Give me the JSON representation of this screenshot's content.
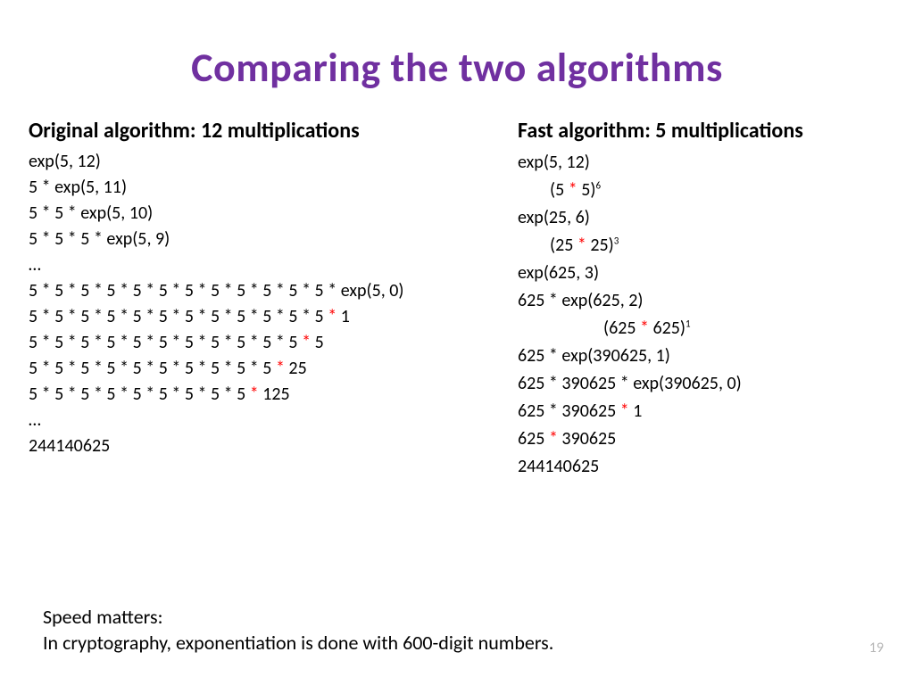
{
  "title": "Comparing the two algorithms",
  "left": {
    "heading": "Original algorithm:  12 multiplications",
    "lines": [
      {
        "pre": "exp(5, 12)"
      },
      {
        "pre": "5 * exp(5, 11)"
      },
      {
        "pre": "5 * 5 * exp(5, 10)"
      },
      {
        "pre": "5 * 5 * 5 * exp(5, 9)"
      },
      {
        "pre": "…"
      },
      {
        "pre": "5 * 5 * 5 * 5 * 5 * 5 * 5 * 5 * 5 * 5 * 5 * 5 * exp(5, 0)"
      },
      {
        "pre": "5 * 5 * 5 * 5 * 5 * 5 * 5 * 5 * 5 * 5 * 5 * 5 ",
        "op": "*",
        "post": " 1"
      },
      {
        "pre": "5 * 5 * 5 * 5 * 5 * 5 * 5 * 5 * 5 * 5 * 5 ",
        "op": "*",
        "post": " 5"
      },
      {
        "pre": "5 * 5 * 5 * 5 * 5 * 5 * 5 * 5 * 5 * 5 ",
        "op": "*",
        "post": " 25"
      },
      {
        "pre": "5 * 5 * 5 * 5 * 5 * 5 * 5 * 5 * 5 ",
        "op": "*",
        "post": " 125"
      },
      {
        "pre": "…"
      },
      {
        "pre": "244140625"
      }
    ]
  },
  "right": {
    "heading": "Fast algorithm:  5 multiplications",
    "lines": [
      {
        "indent": 0,
        "pre": "exp(5, 12)"
      },
      {
        "indent": 1,
        "pre": "(5 ",
        "op": "*",
        "post": " 5)",
        "sup": "6"
      },
      {
        "indent": 0,
        "pre": "exp(25, 6)"
      },
      {
        "indent": 1,
        "pre": "(25 ",
        "op": "*",
        "post": " 25)",
        "sup": "3"
      },
      {
        "indent": 0,
        "pre": "exp(625, 3)"
      },
      {
        "indent": 0,
        "pre": "625 * exp(625, 2)"
      },
      {
        "indent": 2,
        "pre": "(625 ",
        "op": "*",
        "post": " 625)",
        "sup": "1"
      },
      {
        "indent": 0,
        "pre": "625 * exp(390625, 1)"
      },
      {
        "indent": 0,
        "pre": "625 * 390625 * exp(390625, 0)"
      },
      {
        "indent": 0,
        "pre": "625 * 390625 ",
        "op": "*",
        "post": " 1"
      },
      {
        "indent": 0,
        "pre": "625 ",
        "op": "*",
        "post": " 390625"
      },
      {
        "indent": 0,
        "pre": "244140625"
      }
    ]
  },
  "footer": {
    "line1": "Speed matters:",
    "line2": "In cryptography, exponentiation is done with 600-digit numbers."
  },
  "page_number": "19"
}
